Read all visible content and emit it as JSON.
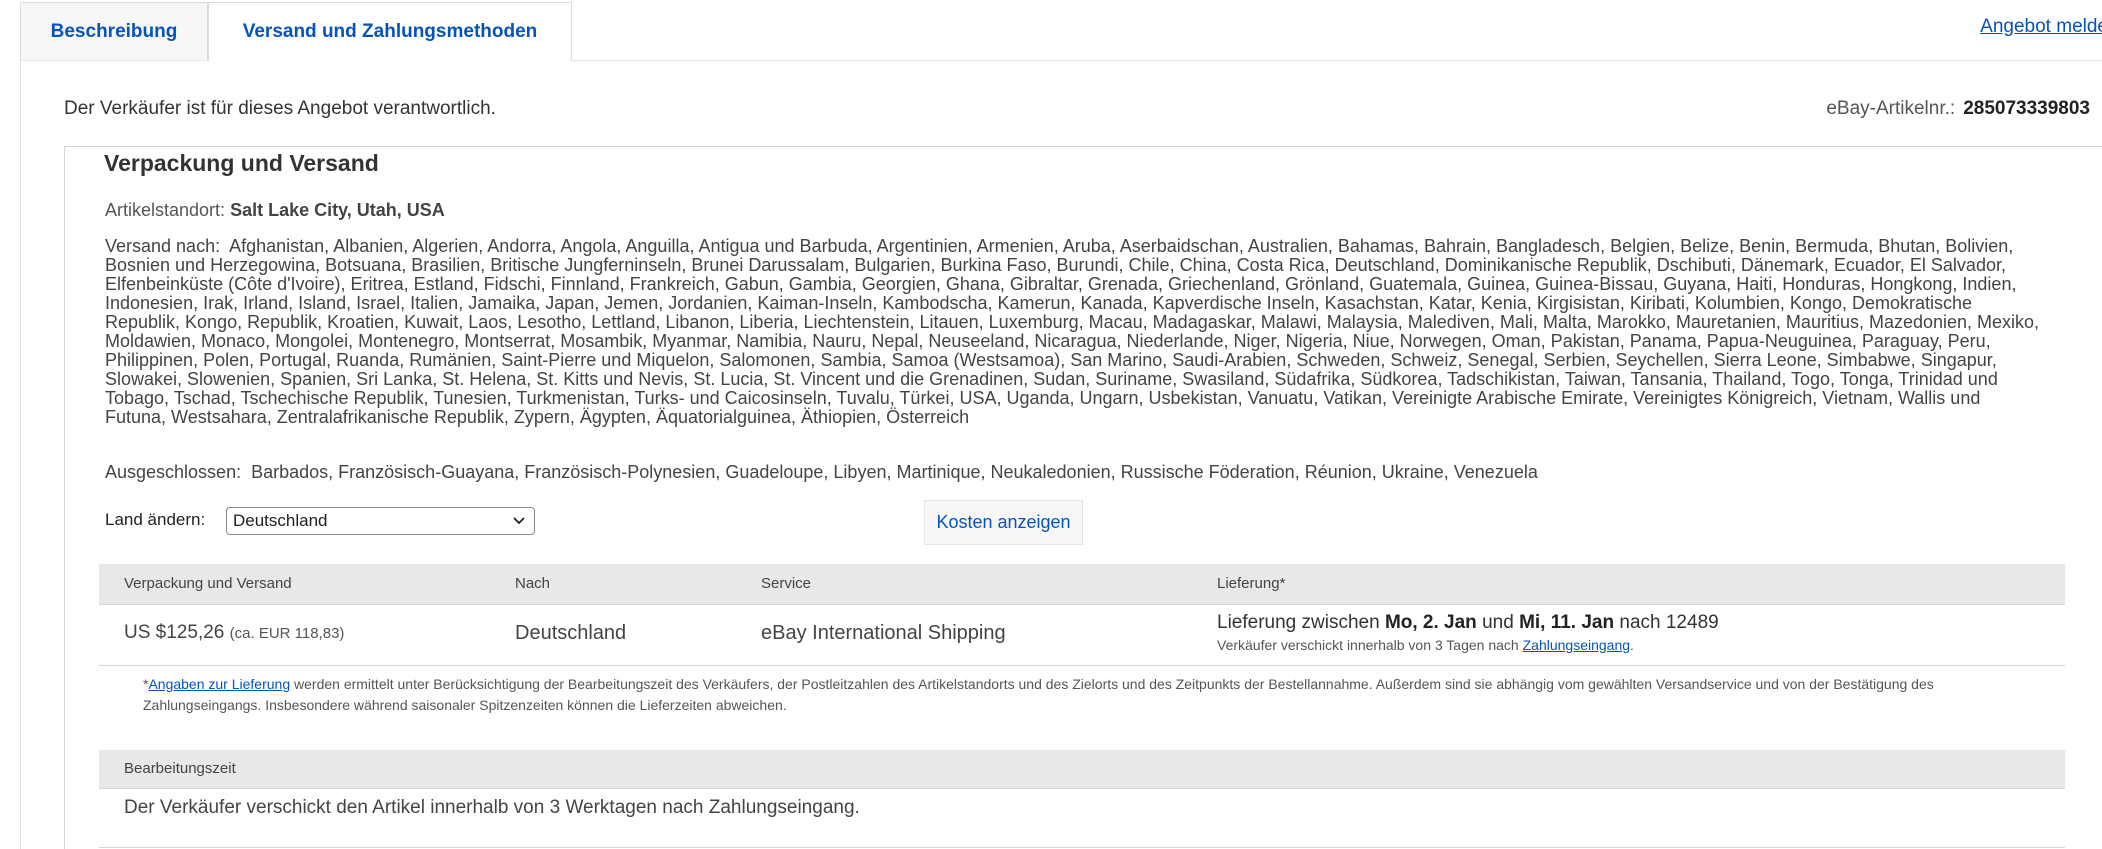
{
  "tabs": [
    {
      "label": "Beschreibung",
      "active": false
    },
    {
      "label": "Versand und Zahlungsmethoden",
      "active": true
    }
  ],
  "report_link": "Angebot melde",
  "seller_responsible": "Der Verkäufer ist für dieses Angebot verantwortlich.",
  "item_number": {
    "label": "eBay-Artikelnr.:",
    "value": "285073339803"
  },
  "shipping": {
    "title": "Verpackung und Versand",
    "location_label": "Artikelstandort:",
    "location_value": "Salt Lake City, Utah, USA",
    "ship_to_label": "Versand nach:",
    "ship_to_countries": "Afghanistan, Albanien, Algerien, Andorra, Angola, Anguilla, Antigua und Barbuda, Argentinien, Armenien, Aruba, Aserbaidschan, Australien, Bahamas, Bahrain, Bangladesch, Belgien, Belize, Benin, Bermuda, Bhutan, Bolivien, Bosnien und Herzegowina, Botsuana, Brasilien, Britische Jungferninseln, Brunei Darussalam, Bulgarien, Burkina Faso, Burundi, Chile, China, Costa Rica, Deutschland, Dominikanische Republik, Dschibuti, Dänemark, Ecuador, El Salvador, Elfenbeinküste (Côte d'Ivoire), Eritrea, Estland, Fidschi, Finnland, Frankreich, Gabun, Gambia, Georgien, Ghana, Gibraltar, Grenada, Griechenland, Grönland, Guatemala, Guinea, Guinea-Bissau, Guyana, Haiti, Honduras, Hongkong, Indien, Indonesien, Irak, Irland, Island, Israel, Italien, Jamaika, Japan, Jemen, Jordanien, Kaiman-Inseln, Kambodscha, Kamerun, Kanada, Kapverdische Inseln, Kasachstan, Katar, Kenia, Kirgisistan, Kiribati, Kolumbien, Kongo, Demokratische Republik, Kongo, Republik, Kroatien, Kuwait, Laos, Lesotho, Lettland, Libanon, Liberia, Liechtenstein, Litauen, Luxemburg, Macau, Madagaskar, Malawi, Malaysia, Malediven, Mali, Malta, Marokko, Mauretanien, Mauritius, Mazedonien, Mexiko, Moldawien, Monaco, Mongolei, Montenegro, Montserrat, Mosambik, Myanmar, Namibia, Nauru, Nepal, Neuseeland, Nicaragua, Niederlande, Niger, Nigeria, Niue, Norwegen, Oman, Pakistan, Panama, Papua-Neuguinea, Paraguay, Peru, Philippinen, Polen, Portugal, Ruanda, Rumänien, Saint-Pierre und Miquelon, Salomonen, Sambia, Samoa (Westsamoa), San Marino, Saudi-Arabien, Schweden, Schweiz, Senegal, Serbien, Seychellen, Sierra Leone, Simbabwe, Singapur, Slowakei, Slowenien, Spanien, Sri Lanka, St. Helena, St. Kitts und Nevis, St. Lucia, St. Vincent und die Grenadinen, Sudan, Suriname, Swasiland, Südafrika, Südkorea, Tadschikistan, Taiwan, Tansania, Thailand, Togo, Tonga, Trinidad und Tobago, Tschad, Tschechische Republik, Tunesien, Turkmenistan, Turks- und Caicosinseln, Tuvalu, Türkei, USA, Uganda, Ungarn, Usbekistan, Vanuatu, Vatikan, Vereinigte Arabische Emirate, Vereinigtes Königreich, Vietnam, Wallis und Futuna, Westsahara, Zentralafrikanische Republik, Zypern, Ägypten, Äquatorialguinea, Äthiopien, Österreich",
    "excluded_label": "Ausgeschlossen:",
    "excluded_countries": "Barbados, Französisch-Guayana, Französisch-Polynesien, Guadeloupe, Libyen, Martinique, Neukaledonien, Russische Föderation, Réunion, Ukraine, Venezuela",
    "change_country_label": "Land ändern:",
    "selected_country": "Deutschland",
    "show_costs_button": "Kosten anzeigen"
  },
  "table": {
    "headers": [
      "Verpackung und Versand",
      "Nach",
      "Service",
      "Lieferung*"
    ],
    "row": {
      "cost": "US $125,26",
      "cost_converted": "(ca. EUR 118,83)",
      "destination": "Deutschland",
      "service": "eBay International Shipping",
      "delivery_prefix": "Lieferung zwischen",
      "delivery_from": "Mo, 2. Jan",
      "delivery_and": "und",
      "delivery_to": "Mi, 11. Jan",
      "delivery_suffix": "nach 12489",
      "delivery_sub_text": "Verkäufer verschickt innerhalb von 3 Tagen nach",
      "delivery_sub_link": "Zahlungseingang",
      "delivery_sub_end": "."
    }
  },
  "note": {
    "star": "*",
    "link": "Angaben zur Lieferung",
    "text": "werden ermittelt unter Berücksichtigung der Bearbeitungszeit des Verkäufers, der Postleitzahlen des Artikelstandorts und des Zielorts und des Zeitpunkts der Bestellannahme. Außerdem sind sie abhängig vom gewählten Versandservice und von der Bestätigung des Zahlungseingangs. Insbesondere während saisonaler Spitzenzeiten können die Lieferzeiten abweichen."
  },
  "handling": {
    "header": "Bearbeitungszeit",
    "text": "Der Verkäufer verschickt den Artikel innerhalb von 3 Werktagen nach Zahlungseingang."
  }
}
